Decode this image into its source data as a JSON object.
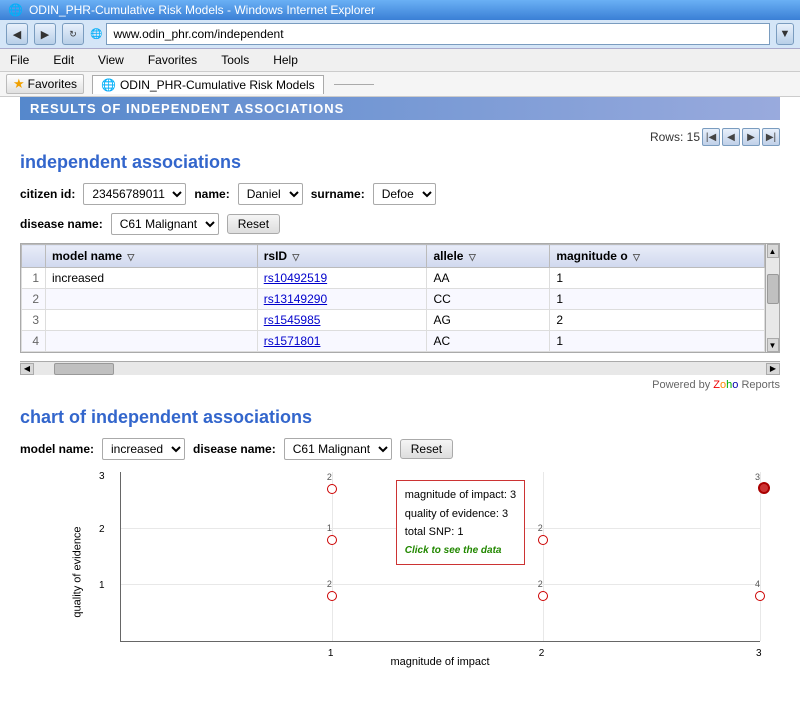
{
  "browser": {
    "title": "ODIN_PHR-Cumulative Risk Models - Windows Internet Explorer",
    "url": "www.odin_phr.com/independent",
    "menus": [
      "File",
      "Edit",
      "View",
      "Favorites",
      "Tools",
      "Help"
    ],
    "favorites_btn": "Favorites",
    "tab_label": "ODIN_PHR-Cumulative Risk Models"
  },
  "section_title": "RESULTS OF INDEPENDENT ASSOCIATIONS",
  "pagination": {
    "label": "Rows:",
    "count": "15"
  },
  "independent": {
    "heading": "independent associations",
    "citizen_id_label": "citizen id:",
    "citizen_id_value": "23456789011",
    "name_label": "name:",
    "name_value": "Daniel",
    "surname_label": "surname:",
    "surname_value": "Defoe",
    "disease_label": "disease name:",
    "disease_value": "C61 Malignant",
    "reset_label": "Reset",
    "table": {
      "columns": [
        "model name",
        "rsID",
        "allele",
        "magnitude o"
      ],
      "rows": [
        {
          "num": "1",
          "model": "increased",
          "rsid": "rs10492519",
          "allele": "AA",
          "magnitude": "1"
        },
        {
          "num": "2",
          "model": "",
          "rsid": "rs13149290",
          "allele": "CC",
          "magnitude": "1"
        },
        {
          "num": "3",
          "model": "",
          "rsid": "rs1545985",
          "allele": "AG",
          "magnitude": "2"
        },
        {
          "num": "4",
          "model": "",
          "rsid": "rs1571801",
          "allele": "AC",
          "magnitude": "1"
        }
      ]
    }
  },
  "powered_by": "Powered by",
  "zoho_reports": "Reports",
  "chart": {
    "heading": "chart of independent associations",
    "model_label": "model name:",
    "model_value": "increased",
    "disease_label": "disease name:",
    "disease_value": "C61 Malignant",
    "reset_label": "Reset",
    "y_axis": "quality of evidence",
    "x_axis": "magnitude of impact",
    "x_ticks": [
      "1",
      "2",
      "3"
    ],
    "y_ticks": [
      "1",
      "2",
      "3"
    ],
    "tooltip": {
      "line1_label": "magnitude of impact:",
      "line1_value": "3",
      "line2_label": "quality of evidence:",
      "line2_value": "3",
      "line3_label": "total SNP:",
      "line3_value": "1",
      "click_text": "Click to see the data"
    },
    "data_points": [
      {
        "x_label": "1",
        "y_label": "3",
        "count": "2"
      },
      {
        "x_label": "1",
        "y_label": "2",
        "count": "1"
      },
      {
        "x_label": "1",
        "y_label": "1",
        "count": "2"
      },
      {
        "x_label": "2",
        "y_label": "2",
        "count": "2"
      },
      {
        "x_label": "2",
        "y_label": "1",
        "count": "2"
      },
      {
        "x_label": "3",
        "y_label": "3",
        "count": "3"
      },
      {
        "x_label": "3",
        "y_label": "1",
        "count": "4"
      }
    ]
  }
}
